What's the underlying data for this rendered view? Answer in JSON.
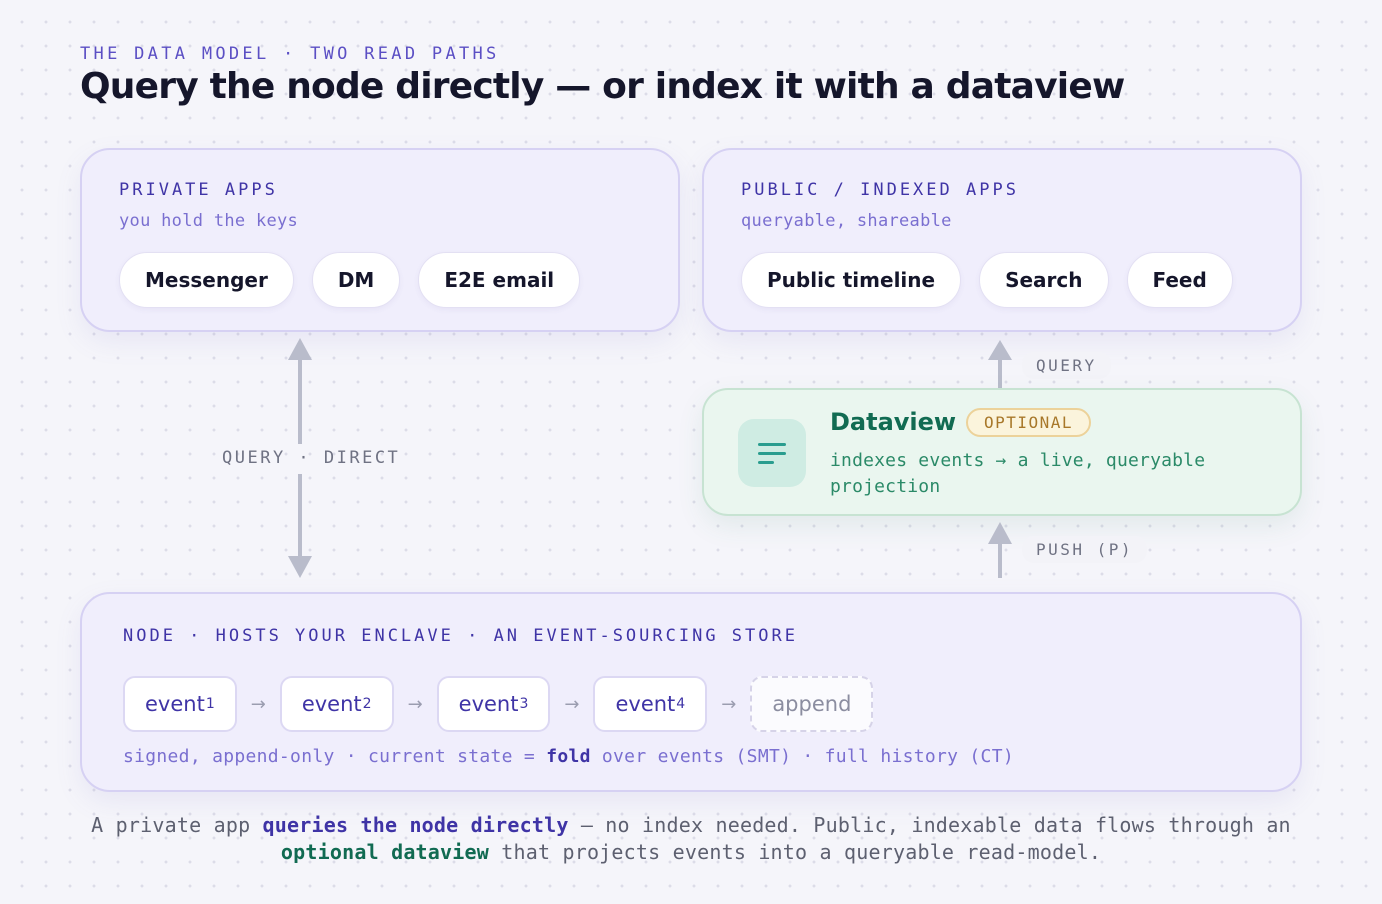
{
  "header": {
    "eyebrow": "THE DATA MODEL · TWO READ PATHS",
    "title": "Query the node directly — or index it with a dataview"
  },
  "private_panel": {
    "label": "PRIVATE APPS",
    "sub": "you hold the keys",
    "chips": [
      "Messenger",
      "DM",
      "E2E email"
    ]
  },
  "public_panel": {
    "label": "PUBLIC / INDEXED APPS",
    "sub": "queryable, shareable",
    "chips": [
      "Public timeline",
      "Search",
      "Feed"
    ]
  },
  "arrows": {
    "direct_label": "QUERY · DIRECT",
    "query_label": "QUERY",
    "push_label": "PUSH (P)"
  },
  "dataview": {
    "title": "Dataview",
    "badge": "OPTIONAL",
    "desc": "indexes events → a live, queryable projection",
    "icon": "lines-icon"
  },
  "node": {
    "label": "NODE · HOSTS YOUR ENCLAVE · AN EVENT-SOURCING STORE",
    "events": [
      {
        "name": "event",
        "sub": "1"
      },
      {
        "name": "event",
        "sub": "2"
      },
      {
        "name": "event",
        "sub": "3"
      },
      {
        "name": "event",
        "sub": "4"
      }
    ],
    "append": "append",
    "arrow_glyph": "→",
    "foot_pre": "signed, append-only · current state = ",
    "foot_bold": "fold",
    "foot_post": " over events (SMT) · full history (CT)"
  },
  "caption": {
    "p1": "A private app ",
    "h1": "queries the node directly",
    "p2": " — no index needed. Public, indexable data flows through an ",
    "h2": "optional dataview",
    "p3": " that projects events into a queryable read-model."
  },
  "colors": {
    "accent": "#3f34a6",
    "green": "#116b52",
    "badge": "#a8782a"
  }
}
